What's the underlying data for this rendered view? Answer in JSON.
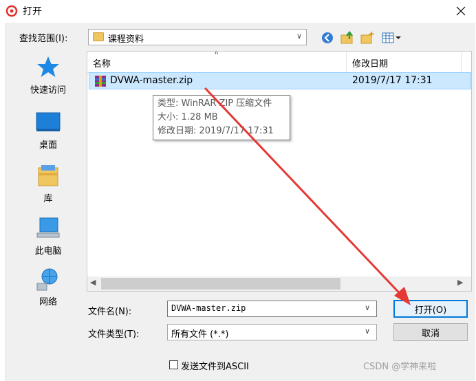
{
  "window": {
    "title": "打开"
  },
  "lookin": {
    "label": "查找范围(I):",
    "value": "课程资料"
  },
  "toolbar": {
    "back_icon": "back-arrow-icon",
    "up_icon": "up-folder-icon",
    "new_folder_icon": "new-folder-icon",
    "view_icon": "view-menu-icon"
  },
  "places": [
    {
      "label": "快速访问",
      "icon": "star-icon"
    },
    {
      "label": "桌面",
      "icon": "desktop-icon"
    },
    {
      "label": "库",
      "icon": "library-icon"
    },
    {
      "label": "此电脑",
      "icon": "computer-icon"
    },
    {
      "label": "网络",
      "icon": "network-icon"
    }
  ],
  "list": {
    "columns": [
      "名称",
      "修改日期"
    ],
    "rows": [
      {
        "name": "DVWA-master.zip",
        "date": "2019/7/17 17:31"
      }
    ]
  },
  "tooltip": {
    "type": "类型: WinRAR ZIP 压缩文件",
    "size": "大小: 1.28 MB",
    "modified": "修改日期: 2019/7/17 17:31"
  },
  "bottom": {
    "filename_label": "文件名(N):",
    "filename_value": "DVWA-master.zip",
    "filetype_label": "文件类型(T):",
    "filetype_value": "所有文件 (*.*)",
    "open_label": "打开(O)",
    "cancel_label": "取消",
    "ascii_label": "发送文件到ASCII"
  },
  "watermark": "CSDN @学神来啦",
  "colors": {
    "accent": "#0078d7",
    "selection": "#cce8ff",
    "annotation": "#e53935"
  }
}
